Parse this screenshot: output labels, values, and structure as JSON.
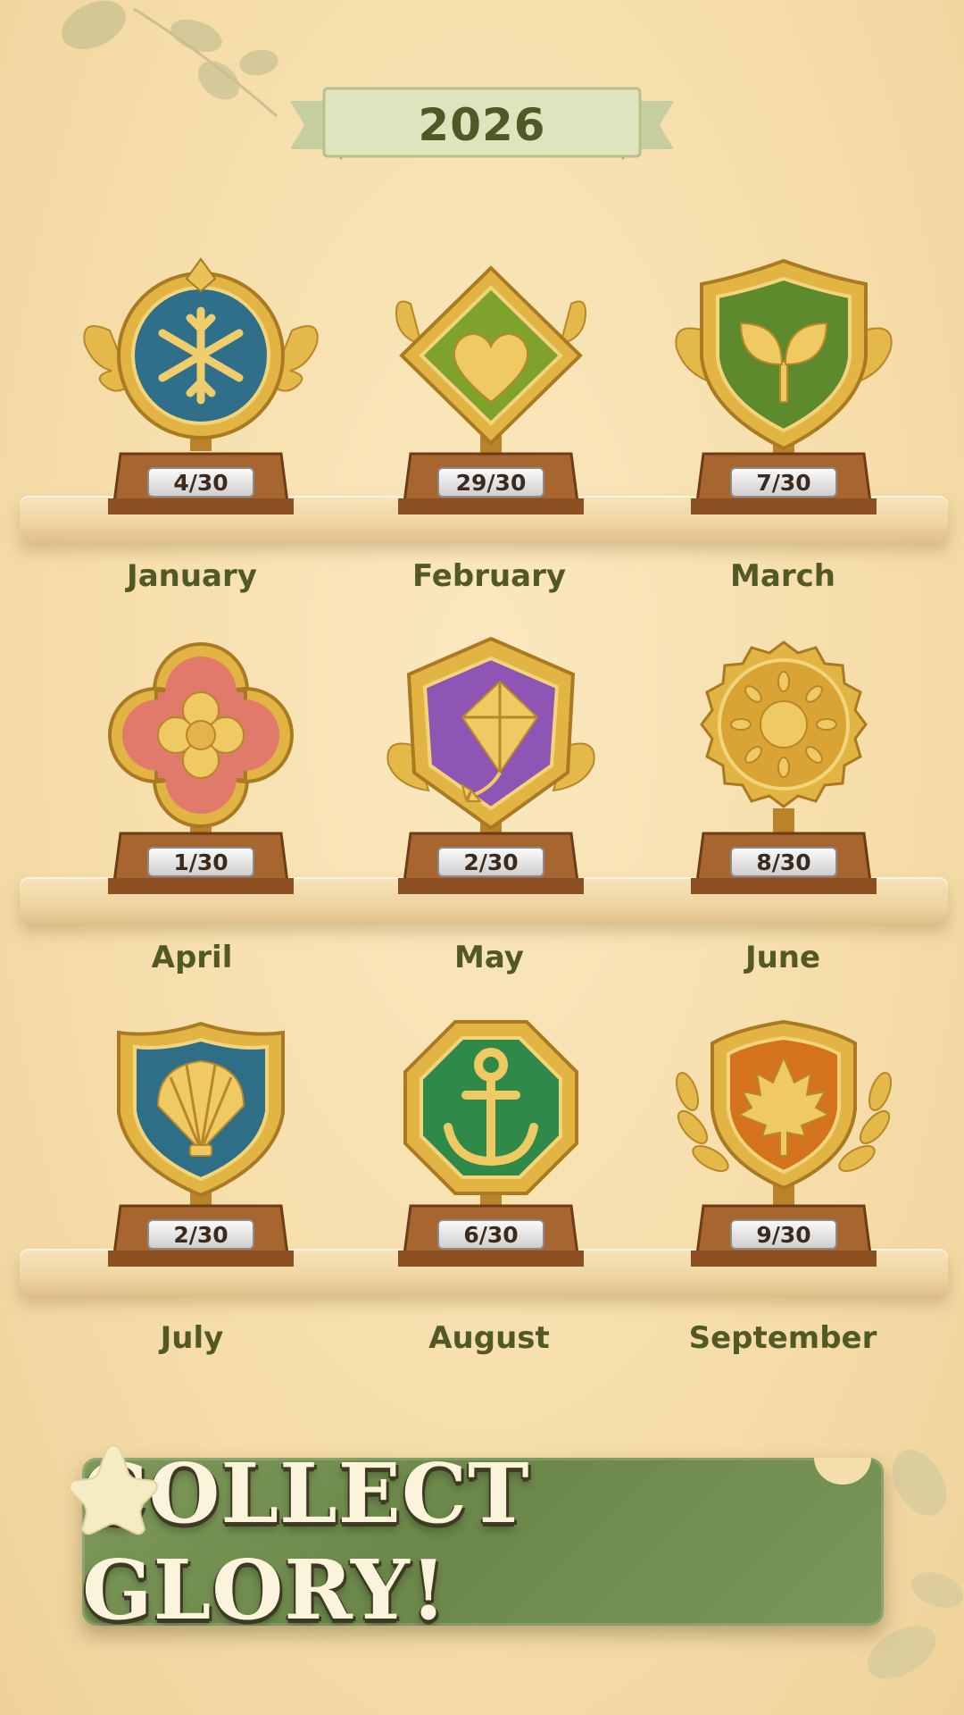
{
  "header": {
    "year": "2026"
  },
  "trophies": [
    {
      "month": "January",
      "progress": "4/30",
      "icon": "snowflake-icon",
      "color": "#2f6f8a"
    },
    {
      "month": "February",
      "progress": "29/30",
      "icon": "heart-icon",
      "color": "#7fa22c"
    },
    {
      "month": "March",
      "progress": "7/30",
      "icon": "sprout-icon",
      "color": "#5d8a2c"
    },
    {
      "month": "April",
      "progress": "1/30",
      "icon": "flower-icon",
      "color": "#e07a6a"
    },
    {
      "month": "May",
      "progress": "2/30",
      "icon": "kite-icon",
      "color": "#8e55b5"
    },
    {
      "month": "June",
      "progress": "8/30",
      "icon": "sun-icon",
      "color": "#d9a433"
    },
    {
      "month": "July",
      "progress": "2/30",
      "icon": "shell-icon",
      "color": "#2e6e86"
    },
    {
      "month": "August",
      "progress": "6/30",
      "icon": "anchor-icon",
      "color": "#2f8a4a"
    },
    {
      "month": "September",
      "progress": "9/30",
      "icon": "maple-leaf-icon",
      "color": "#d4731c"
    }
  ],
  "cta": {
    "label": "COLLECT GLORY!"
  }
}
